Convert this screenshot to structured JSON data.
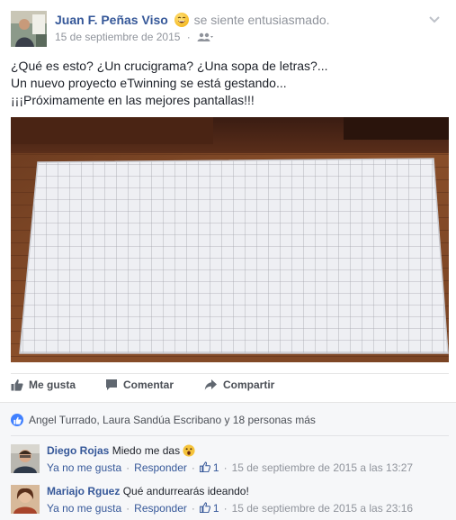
{
  "post": {
    "author": "Juan F. Peñas Viso",
    "feeling": "se siente entusiasmado.",
    "date": "15 de septiembre de 2015",
    "text_lines": [
      "¿Qué es esto? ¿Un crucigrama? ¿Una sopa de letras?...",
      "Un nuevo proyecto eTwinning se está gestando...",
      "¡¡¡Próximamente en las mejores pantallas!!!"
    ]
  },
  "actions": {
    "like": "Me gusta",
    "comment": "Comentar",
    "share": "Compartir"
  },
  "likes_summary": "Angel Turrado, Laura Sandúa Escribano y 18 personas más",
  "comments": [
    {
      "name": "Diego Rojas",
      "text": "Miedo me das",
      "unlike": "Ya no me gusta",
      "reply": "Responder",
      "likes": "1",
      "timestamp": "15 de septiembre de 2015 a las 13:27"
    },
    {
      "name": "Mariajo Rguez",
      "text": "Qué andurrearás ideando!",
      "unlike": "Ya no me gusta",
      "reply": "Responder",
      "likes": "1",
      "timestamp": "15 de septiembre de 2015 a las 23:16"
    }
  ],
  "separator": "·",
  "colors": {
    "link": "#365899",
    "meta": "#90949c",
    "like_badge": "#4080ff",
    "comments_bg": "#f6f7f9"
  }
}
